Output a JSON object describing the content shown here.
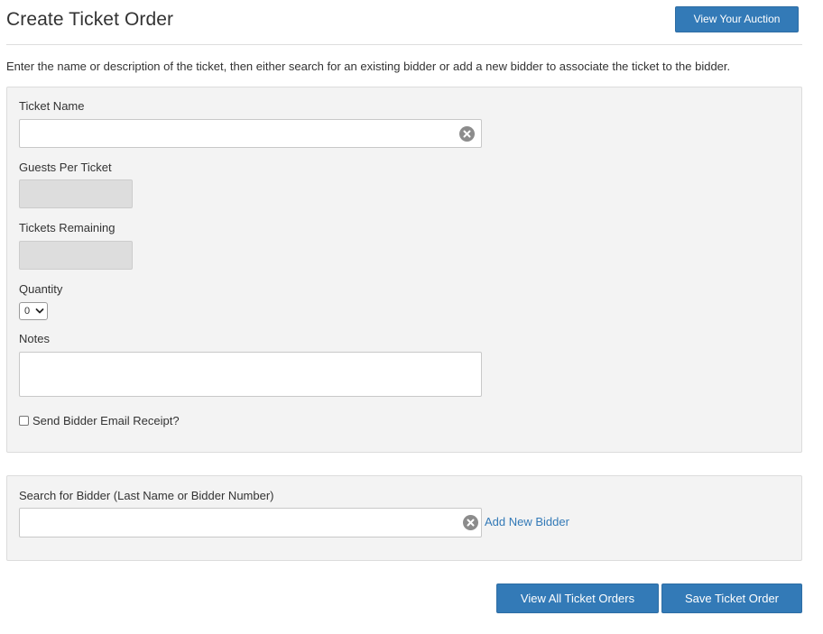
{
  "header": {
    "title": "Create Ticket Order",
    "view_auction_label": "View Your Auction"
  },
  "intro_text": "Enter the name or description of the ticket, then either search for an existing bidder or add a new bidder to associate the ticket to the bidder.",
  "ticket_form": {
    "ticket_name_label": "Ticket Name",
    "ticket_name_value": "",
    "guests_per_ticket_label": "Guests Per Ticket",
    "guests_per_ticket_value": "",
    "tickets_remaining_label": "Tickets Remaining",
    "tickets_remaining_value": "",
    "quantity_label": "Quantity",
    "quantity_value": "0",
    "notes_label": "Notes",
    "notes_value": "",
    "send_receipt_label": "Send Bidder Email Receipt?",
    "send_receipt_checked": false
  },
  "bidder_form": {
    "search_label": "Search for Bidder (Last Name or Bidder Number)",
    "search_value": "",
    "add_new_bidder_label": "Add New Bidder"
  },
  "footer": {
    "view_all_label": "View All Ticket Orders",
    "save_label": "Save Ticket Order"
  },
  "colors": {
    "primary": "#337ab7",
    "panel_bg": "#f3f3f3",
    "readonly_bg": "#dddddd",
    "clear_icon": "#8c8c8c"
  },
  "icons": {
    "clear": "clear-x-circle-icon",
    "select_caret": "chevron-down-icon"
  }
}
